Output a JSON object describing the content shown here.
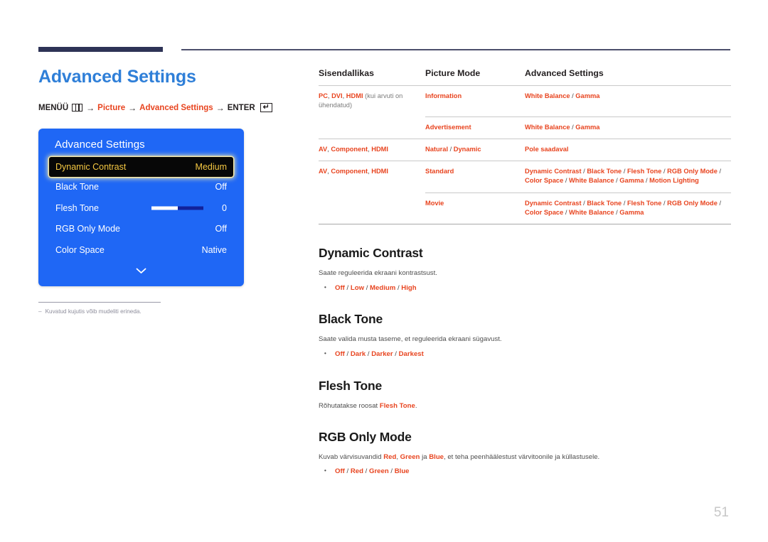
{
  "header": {
    "rule_color": "#2e3356"
  },
  "left": {
    "title": "Advanced Settings",
    "menu_path": {
      "prefix": "MENÜÜ",
      "menu_icon": "menu-grid-icon",
      "arrow1": "→",
      "step1": "Picture",
      "arrow2": "→",
      "step2": "Advanced Settings",
      "arrow3": "→",
      "enter": "ENTER",
      "enter_icon": "↵"
    },
    "osd": {
      "title": "Advanced Settings",
      "accent_color": "#1f67f5",
      "highlight_bg": "#070707",
      "highlight_fg": "#f5c842",
      "rows": [
        {
          "label": "Dynamic Contrast",
          "value": "Medium",
          "selected": true,
          "slider": false
        },
        {
          "label": "Black Tone",
          "value": "Off",
          "selected": false,
          "slider": false
        },
        {
          "label": "Flesh Tone",
          "value": "0",
          "selected": false,
          "slider": true
        },
        {
          "label": "RGB Only Mode",
          "value": "Off",
          "selected": false,
          "slider": false
        },
        {
          "label": "Color Space",
          "value": "Native",
          "selected": false,
          "slider": false
        }
      ],
      "more_icon": "chevron-down-icon"
    },
    "footnote_dash": "–",
    "footnote": "Kuvatud kujutis võib mudeliti erineda."
  },
  "table": {
    "headers": [
      "Sisendallikas",
      "Picture Mode",
      "Advanced Settings"
    ],
    "rows": [
      {
        "source_accent": "PC, DVI, HDMI",
        "source_note": "(kui arvuti on ühendatud)",
        "mode": "Information",
        "settings": "White Balance / Gamma",
        "settings_muted": false,
        "top_border": "full"
      },
      {
        "source_accent": "",
        "source_note": "",
        "mode": "Advertisement",
        "settings": "White Balance / Gamma",
        "settings_muted": false,
        "top_border": "partial"
      },
      {
        "source_accent": "AV, Component, HDMI",
        "source_note": "",
        "mode": "Natural / Dynamic",
        "settings": "Pole saadaval",
        "settings_muted": true,
        "top_border": "full"
      },
      {
        "source_accent": "AV, Component, HDMI",
        "source_note": "",
        "mode": "Standard",
        "settings": "Dynamic Contrast / Black Tone / Flesh Tone / RGB Only Mode / Color Space / White Balance / Gamma / Motion Lighting",
        "settings_muted": false,
        "top_border": "full"
      },
      {
        "source_accent": "",
        "source_note": "",
        "mode": "Movie",
        "settings": "Dynamic Contrast / Black Tone / Flesh Tone / RGB Only Mode / Color Space / White Balance / Gamma",
        "settings_muted": false,
        "top_border": "partial"
      }
    ]
  },
  "sections": [
    {
      "heading": "Dynamic Contrast",
      "description": "Saate reguleerida ekraani kontrastsust.",
      "options": "Off / Low / Medium / High"
    },
    {
      "heading": "Black Tone",
      "description": "Saate valida musta taseme, et reguleerida ekraani sügavust.",
      "options": "Off / Dark / Darker / Darkest"
    },
    {
      "heading": "Flesh Tone",
      "description": "Rõhutatakse roosat Flesh Tone.",
      "options": ""
    },
    {
      "heading": "RGB Only Mode",
      "description": "Kuvab värvisuvandid Red, Green ja Blue, et teha peenhäälestust värvitoonile ja küllastusele.",
      "options": "Off / Red / Green / Blue"
    }
  ],
  "page_number": "51"
}
